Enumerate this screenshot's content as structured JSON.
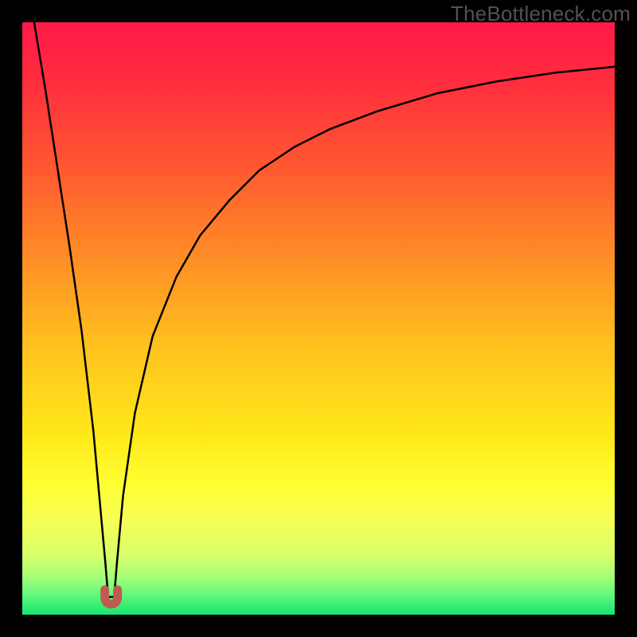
{
  "watermark": "TheBottleneck.com",
  "colors": {
    "frame": "#000000",
    "curve": "#000000",
    "gradient_stops": [
      {
        "offset": 0.0,
        "color": "#FF1948"
      },
      {
        "offset": 0.1,
        "color": "#FF2D3E"
      },
      {
        "offset": 0.25,
        "color": "#FF5A30"
      },
      {
        "offset": 0.4,
        "color": "#FF8E26"
      },
      {
        "offset": 0.55,
        "color": "#FFC21E"
      },
      {
        "offset": 0.7,
        "color": "#FFE91A"
      },
      {
        "offset": 0.78,
        "color": "#FFFF32"
      },
      {
        "offset": 0.84,
        "color": "#F7FF55"
      },
      {
        "offset": 0.9,
        "color": "#D7FF6A"
      },
      {
        "offset": 0.935,
        "color": "#A8FF77"
      },
      {
        "offset": 0.965,
        "color": "#64F97B"
      },
      {
        "offset": 1.0,
        "color": "#16E570"
      }
    ],
    "marker": "#C05C4F"
  },
  "chart_data": {
    "type": "line",
    "title": "",
    "xlabel": "",
    "ylabel": "",
    "xlim": [
      0,
      100
    ],
    "ylim": [
      0,
      100
    ],
    "series": [
      {
        "name": "bottleneck-curve",
        "x": [
          2,
          4,
          6,
          8,
          10,
          12,
          13,
          14,
          14.5,
          15.5,
          16,
          17,
          19,
          22,
          26,
          30,
          35,
          40,
          46,
          52,
          60,
          70,
          80,
          90,
          100
        ],
        "y": [
          100,
          88,
          75,
          62,
          48,
          31,
          20,
          9,
          3,
          3,
          9,
          20,
          34,
          47,
          57,
          64,
          70,
          75,
          79,
          82,
          85,
          88,
          90,
          91.5,
          92.5
        ]
      }
    ],
    "annotations": [
      {
        "name": "min-marker",
        "x": 15,
        "y": 3,
        "shape": "u"
      }
    ]
  }
}
